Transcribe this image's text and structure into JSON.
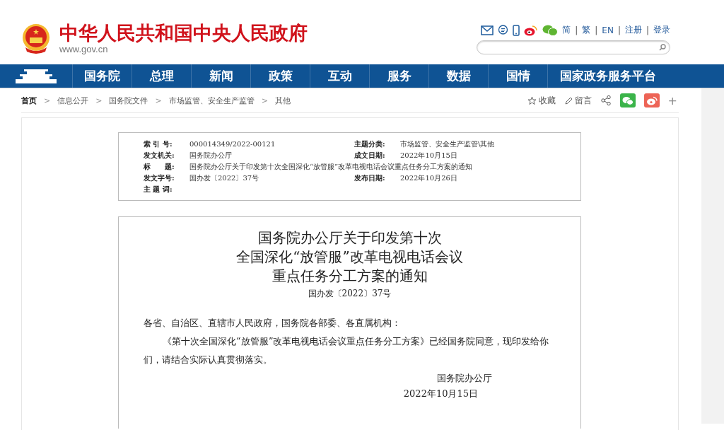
{
  "header": {
    "site_title": "中华人民共和国中央人民政府",
    "site_url": "www.gov.cn",
    "lang_links": [
      "简",
      "繁",
      "EN",
      "注册",
      "登录"
    ],
    "link_separator": "|"
  },
  "nav": {
    "items": [
      {
        "label": "国务院",
        "selected": false
      },
      {
        "label": "总理",
        "selected": false
      },
      {
        "label": "新闻",
        "selected": false
      },
      {
        "label": "政策",
        "selected": false
      },
      {
        "label": "互动",
        "selected": false
      },
      {
        "label": "服务",
        "selected": false
      },
      {
        "label": "数据",
        "selected": false
      },
      {
        "label": "国情",
        "selected": false
      },
      {
        "label": "国家政务服务平台",
        "selected": false
      }
    ]
  },
  "breadcrumb": [
    "首页",
    "信息公开",
    "国务院文件",
    "市场监管、安全生产监管",
    "其他"
  ],
  "breadcrumb_separator": ">",
  "actions": {
    "favorite": "收藏",
    "comment": "留言",
    "plus": "+"
  },
  "meta": [
    {
      "label": "索 引 号:",
      "value": "000014349/2022-00121",
      "label2": "主题分类:",
      "value2": "市场监管、安全生产监管\\其他"
    },
    {
      "label": "发文机关:",
      "value": "国务院办公厅",
      "label2": "成文日期:",
      "value2": "2022年10月15日"
    },
    {
      "label": "标　　题:",
      "value": "国务院办公厅关于印发第十次全国深化“放管服”改革电视电话会议重点任务分工方案的通知"
    },
    {
      "label": "发文字号:",
      "value": "国办发〔2022〕37号",
      "label2": "发布日期:",
      "value2": "2022年10月26日"
    },
    {
      "label": "主 题 词:"
    }
  ],
  "document": {
    "title_lines": [
      "国务院办公厅关于印发第十次",
      "全国深化“放管服”改革电视电话会议",
      "重点任务分工方案的通知"
    ],
    "doc_number": "国办发〔2022〕37号",
    "paragraphs": [
      {
        "kind": "salutation",
        "text": "各省、自治区、直辖市人民政府，国务院各部委、各直属机构："
      },
      {
        "kind": "body",
        "text": "《第十次全国深化“放管服”改革电视电话会议重点任务分工方案》已经国务院同意，现印发给你们，请结合实际认真贯彻落实。"
      }
    ],
    "signature": "国务院办公厅",
    "date": "2022年10月15日"
  }
}
